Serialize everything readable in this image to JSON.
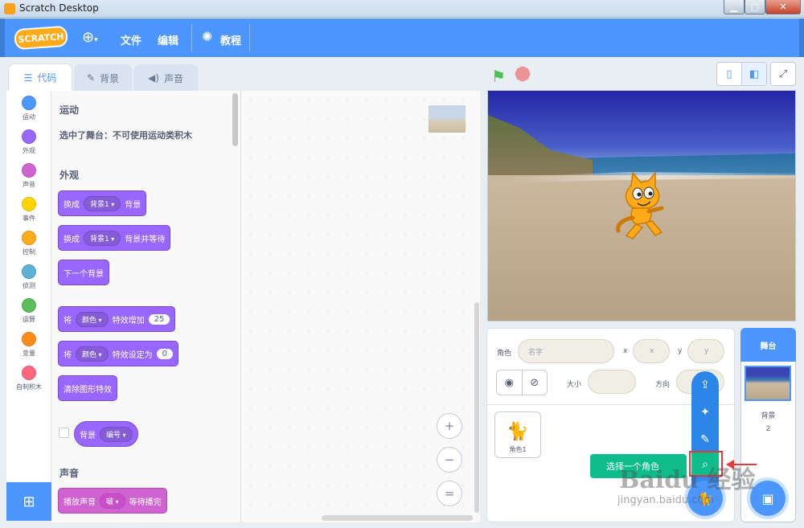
{
  "window": {
    "title": "Scratch Desktop",
    "min": "▁",
    "max": "▢",
    "close": "✕"
  },
  "menubar": {
    "logo": "SCRATCH",
    "language_icon": "globe-icon",
    "file": "文件",
    "edit": "编辑",
    "tutorials": "教程"
  },
  "tabs": [
    {
      "label": "代码",
      "icon": "code-icon"
    },
    {
      "label": "背景",
      "icon": "brush-icon"
    },
    {
      "label": "声音",
      "icon": "speaker-icon"
    }
  ],
  "categories": [
    {
      "label": "运动",
      "color": "#4c97ff"
    },
    {
      "label": "外观",
      "color": "#9966ff"
    },
    {
      "label": "声音",
      "color": "#cf63cf"
    },
    {
      "label": "事件",
      "color": "#ffd500"
    },
    {
      "label": "控制",
      "color": "#ffab19"
    },
    {
      "label": "侦测",
      "color": "#5cb1d6"
    },
    {
      "label": "运算",
      "color": "#59c059"
    },
    {
      "label": "变量",
      "color": "#ff8c1a"
    },
    {
      "label": "自制积木",
      "color": "#ff6680"
    }
  ],
  "palette": {
    "motion_title": "运动",
    "motion_note": "选中了舞台：不可使用运动类积木",
    "looks_title": "外观",
    "b1": {
      "pre": "换成",
      "drop": "背景1",
      "post": "背景"
    },
    "b2": {
      "pre": "换成",
      "drop": "背景1",
      "post": "背景并等待"
    },
    "b3": {
      "text": "下一个背景"
    },
    "b4": {
      "pre": "将",
      "drop": "颜色",
      "mid": "特效增加",
      "num": "25"
    },
    "b5": {
      "pre": "将",
      "drop": "颜色",
      "mid": "特效设定为",
      "num": "0"
    },
    "b6": {
      "text": "清除图形特效"
    },
    "b7": {
      "pre": "背景",
      "drop": "编号"
    },
    "sound_title": "声音",
    "b8": {
      "pre": "播放声音",
      "drop": "啵",
      "post": "等待播完"
    }
  },
  "zoom": {
    "in": "+",
    "out": "−",
    "reset": "="
  },
  "stage_controls": {
    "flag_icon": "green-flag-icon",
    "stop_icon": "stop-icon"
  },
  "sprite_info": {
    "sprite_label": "角色",
    "name_placeholder": "名字",
    "x_label": "x",
    "x_value": "x",
    "y_label": "y",
    "y_value": "y",
    "show_label": "显示",
    "size_label": "大小",
    "direction_label": "方向"
  },
  "sprite_list": [
    {
      "name": "角色1"
    }
  ],
  "stage_panel": {
    "header": "舞台",
    "backdrops_label": "背景",
    "backdrops_count": "2"
  },
  "add_sprite_menu": {
    "tooltip": "选择一个角色",
    "items": [
      "upload-icon",
      "surprise-icon",
      "paint-icon",
      "search-icon"
    ]
  },
  "watermark": {
    "main": "Baidu 经验",
    "url": "jingyan.baidu.com"
  }
}
